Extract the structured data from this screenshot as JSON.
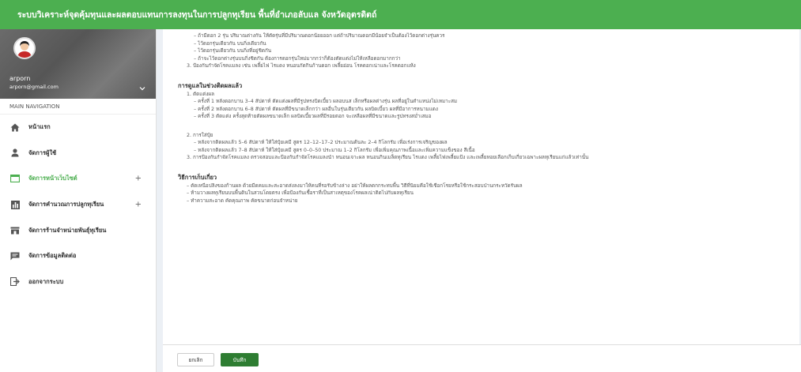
{
  "header": {
    "title": "ระบบวิเคราะห์จุดคุ้มทุนและผลตอบแทนการลงทุนในการปลูกทุเรียน พื้นที่อำเภอลับแล จังหวัดอุตรดิตถ์",
    "bg_color": "#4caf50"
  },
  "user": {
    "name": "arporn",
    "email": "arporn@gmail.com"
  },
  "nav": {
    "header": "MAIN NAVIGATION",
    "items": [
      {
        "label": "หน้าแรก",
        "icon": "home-icon"
      },
      {
        "label": "จัดการผู้ใช้",
        "icon": "person-icon"
      },
      {
        "label": "จัดการหน้าเว็บไซต์",
        "icon": "window-icon",
        "active": true,
        "plus": "+"
      },
      {
        "label": "จัดการคำนวณการปลูกทุเรียน",
        "icon": "chart-icon",
        "plus": "+"
      },
      {
        "label": "จัดการร้านจำหน่ายพันธุ์ทุเรียน",
        "icon": "store-icon"
      },
      {
        "label": "จัดการข้อมูลติดต่อ",
        "icon": "chat-icon"
      },
      {
        "label": "ออกจากระบบ",
        "icon": "logout-icon"
      }
    ],
    "accent_color": "#4caf50"
  },
  "content": {
    "lines_top": [
      "– ถ้ามีดอก 2 รุ่น ปริมาณต่างกัน ให้ตัดรุ่นที่มีปริมาณดอกน้อยออก แต่ถ้าปริมาณดอกมีน้อยจำเป็นต้องไว้ดอกต่างรุ่นควร",
      "– ไว้ดอกรุ่นเดียวกัน บนกิ่งเดียวกัน",
      "– ไว้ดอกรุ่นเดียวกัน บนกิ่งที่อยู่ชิดกัน",
      "– ถ้าจะไว้ดอกต่างรุ่นบนกิ่งชิดกัน ต้องการดอกรุ่นใหม่มากกว่าก็ต้องตัดแต่งไม่ให้เหลือดอกมากกว่า",
      "3. ป้องกันกำจัดโรคแมลง เช่น เพลี้ยไฟ ไรแดง หนอนกัดกินก้านดอก เพลี้ยอ่อน โรคดอกเน่าและโรคดอกแห้ง"
    ],
    "section1": {
      "title": "การดูแลในช่วงติดผลแล้ว",
      "sub1": "1. ตัดแต่งผล",
      "sub1_items": [
        "– ครั้งที่ 1 หลังดอกบาน 3–4 สัปดาห์ ตัดแต่งผลที่มีรูปทรงบิดเบี้ยว ผลอบนส เล็กหรือผลต่างรุ่น ผลที่อยู่ในตำแหน่งไม่เหมาะสม",
        "– ครั้งที่ 2 หลังดอกบาน 6–8 สัปดาห์ ตัดผลที่มีขนาดเล็กกว่า ผลอื่นในรุ่นเดียวกัน ผลบิดเบี้ยว ผลที่มีอาการหนามแดง",
        "– ครั้งที่ 3 ตัดแต่ง ครั้งสุดท้ายตัดผลขนาดเล็ก ผลบิดเบี้ยวผลที่มีรอยตอก จะเหลือผลที่มีขนาดและรูปทรงสม่ำเสมอ"
      ],
      "sub2": "2. การใส่ปุ๋ย",
      "sub2_items": [
        "– หลังจากติดผลแล้ว 5–6 สัปดาห์ ให้ใส่ปุ๋ยเคมี สูตร 12–12–17–2 ประมาณต้นละ 2–4 กิโลกรัม เพื่อเร่งการเจริญของผล",
        "– หลังจากติดผลแล้ว 7–8 สัปดาห์ ให้ใส่ปุ๋ยเคมี สูตร 0–0–50 ประมาณ 1–2 กิโลกรัม เพื่อเพิ่มคุณภาพเนื้อและเพิ่มความแข็งของ สีเนื้อ"
      ],
      "sub3": "3. การป้องกันกำจัดโรคแมลง ตรวจสอบและป้องกันกำจัดโรคแมลงนำ หนอนเจาะผล หนอนกินเมล็ดทุเรียน ไรแดง เพลี้ยไฟเพลี้ยแป้ง และเพลี้ยหอยเลือกเก็บเกี่ยวเฉพาะผลทุเรียนแก่แล้วเท่านั้น"
    },
    "section2": {
      "title": "วิธีการเก็บเกี่ยว",
      "items": [
        "– ตัดเหนือปลิงของก้านผล ด้วยมีดคมและสะอาดส่งลงมาให้คนที่รอรับข้างล่าง อย่าให้ผลตกกระทบพื้น วิธีที่นิยมคือใช้เชือกโรยหรือใช้กระสอบป่านกระหวัดรับผล",
        "– ห้ามวางผลทุเรียนบนพื้นดินในสวนโดยตรง เพื่อป้องกันเชื้อราที่เป็นสาเหตุของโรคผลเน่าติดไปกับผลทุเรียน",
        "– ทำความสะอาด คัดคุณภาพ คัดขนาดก่อนจำหน่าย"
      ]
    }
  },
  "footer": {
    "cancel_label": "ยกเลิก",
    "save_label": "บันทึก",
    "save_color": "#2e7d32"
  }
}
